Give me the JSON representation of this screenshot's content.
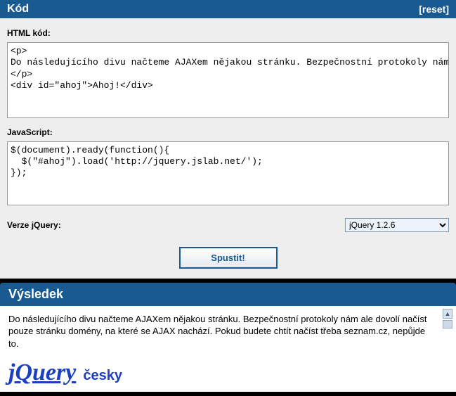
{
  "code_panel": {
    "title": "Kód",
    "reset_label": "[reset]",
    "html_label": "HTML kód:",
    "html_value": "<p>\nDo následujícího divu načteme AJAXem nějakou stránku. Bezpečnostní protokoly nám ale dovolí načíst pouze stránku domény, na které se AJAX nachází. Pokud budete chtít načíst třeba seznam.cz, nepůjde to.\n</p>\n<div id=\"ahoj\">Ahoj!</div>",
    "js_label": "JavaScript:",
    "js_value": "$(document).ready(function(){\n  $(\"#ahoj\").load('http://jquery.jslab.net/');\n});",
    "version_label": "Verze jQuery:",
    "version_selected": "jQuery 1.2.6",
    "run_label": "Spustit!"
  },
  "result_panel": {
    "title": "Výsledek",
    "paragraph": "Do následujícího divu načteme AJAXem nějakou stránku. Bezpečnostní protokoly nám ale dovolí načíst pouze stránku domény, na které se AJAX nachází. Pokud budete chtít načíst třeba seznam.cz, nepůjde to.",
    "logo_main": "jQuery",
    "logo_sub": "česky"
  }
}
